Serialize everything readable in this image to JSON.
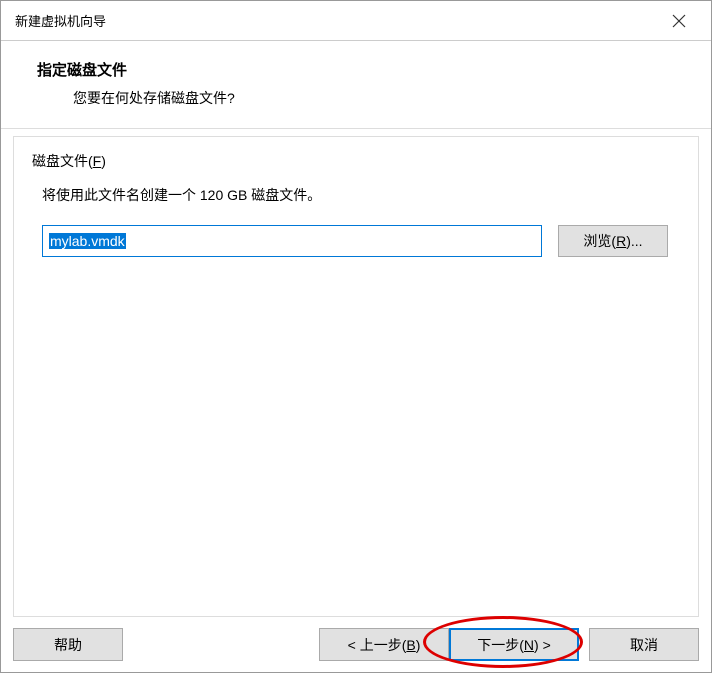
{
  "window": {
    "title": "新建虚拟机向导"
  },
  "header": {
    "title": "指定磁盘文件",
    "subtitle": "您要在何处存储磁盘文件?"
  },
  "content": {
    "field_label_prefix": "磁盘文件(",
    "field_label_mnemonic": "F",
    "field_label_suffix": ")",
    "description": "将使用此文件名创建一个 120 GB 磁盘文件。",
    "filename_value": "mylab.vmdk",
    "browse_label_prefix": "浏览(",
    "browse_mnemonic": "R",
    "browse_label_suffix": ")..."
  },
  "buttons": {
    "help": "帮助",
    "back_prefix": "< 上一步(",
    "back_mnemonic": "B",
    "back_suffix": ")",
    "next_prefix": "下一步(",
    "next_mnemonic": "N",
    "next_suffix": ") >",
    "cancel": "取消"
  }
}
